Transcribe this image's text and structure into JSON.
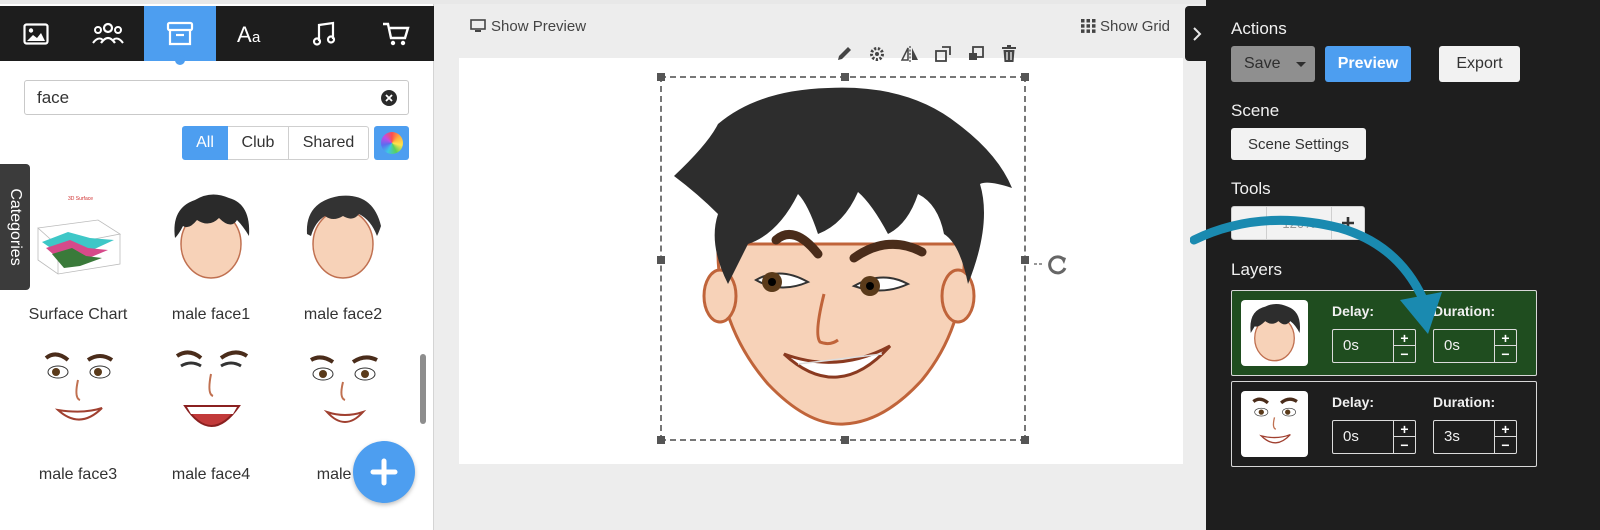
{
  "left_toolbar": {
    "tabs": [
      {
        "name": "images",
        "icon": "image-icon",
        "active": false
      },
      {
        "name": "characters",
        "icon": "people-icon",
        "active": false
      },
      {
        "name": "props",
        "icon": "archive-box-icon",
        "active": true
      },
      {
        "name": "text",
        "icon": "text-aa-icon",
        "active": false
      },
      {
        "name": "music",
        "icon": "music-note-icon",
        "active": false
      },
      {
        "name": "shop",
        "icon": "shopping-cart-icon",
        "active": false
      }
    ],
    "collapse_icon": "chevron-left-icon"
  },
  "search": {
    "value": "face",
    "placeholder": ""
  },
  "filters": {
    "all": "All",
    "club": "Club",
    "shared": "Shared",
    "active": "All"
  },
  "categories_label": "Categories",
  "assets": [
    {
      "label": "Surface Chart",
      "kind": "chart"
    },
    {
      "label": "male face1",
      "kind": "hair-face"
    },
    {
      "label": "male face2",
      "kind": "hair-face"
    },
    {
      "label": "male face3",
      "kind": "expression"
    },
    {
      "label": "male face4",
      "kind": "expression"
    },
    {
      "label": "male fa",
      "kind": "expression"
    }
  ],
  "canvas": {
    "show_preview": "Show Preview",
    "show_grid": "Show Grid",
    "object_tools": [
      "pencil-icon",
      "gear-icon",
      "flip-icon",
      "bring-forward-icon",
      "send-backward-icon",
      "trash-icon"
    ]
  },
  "right_panel": {
    "actions_heading": "Actions",
    "save_label": "Save",
    "preview_label": "Preview",
    "export_label": "Export",
    "scene_heading": "Scene",
    "scene_settings_label": "Scene Settings",
    "tools_heading": "Tools",
    "zoom_value": "120%",
    "layers_heading": "Layers",
    "layers": [
      {
        "delay_label": "Delay:",
        "delay": "0s",
        "duration_label": "Duration:",
        "duration": "0s",
        "selected": true
      },
      {
        "delay_label": "Delay:",
        "delay": "0s",
        "duration_label": "Duration:",
        "duration": "3s",
        "selected": false
      }
    ]
  },
  "colors": {
    "accent": "#4d9ef0",
    "toolbar_bg": "#1d1d1d",
    "panel_bg": "#1e1e1e",
    "selected_layer": "#1f4d1f",
    "annotation_arrow": "#1a8ab0"
  }
}
